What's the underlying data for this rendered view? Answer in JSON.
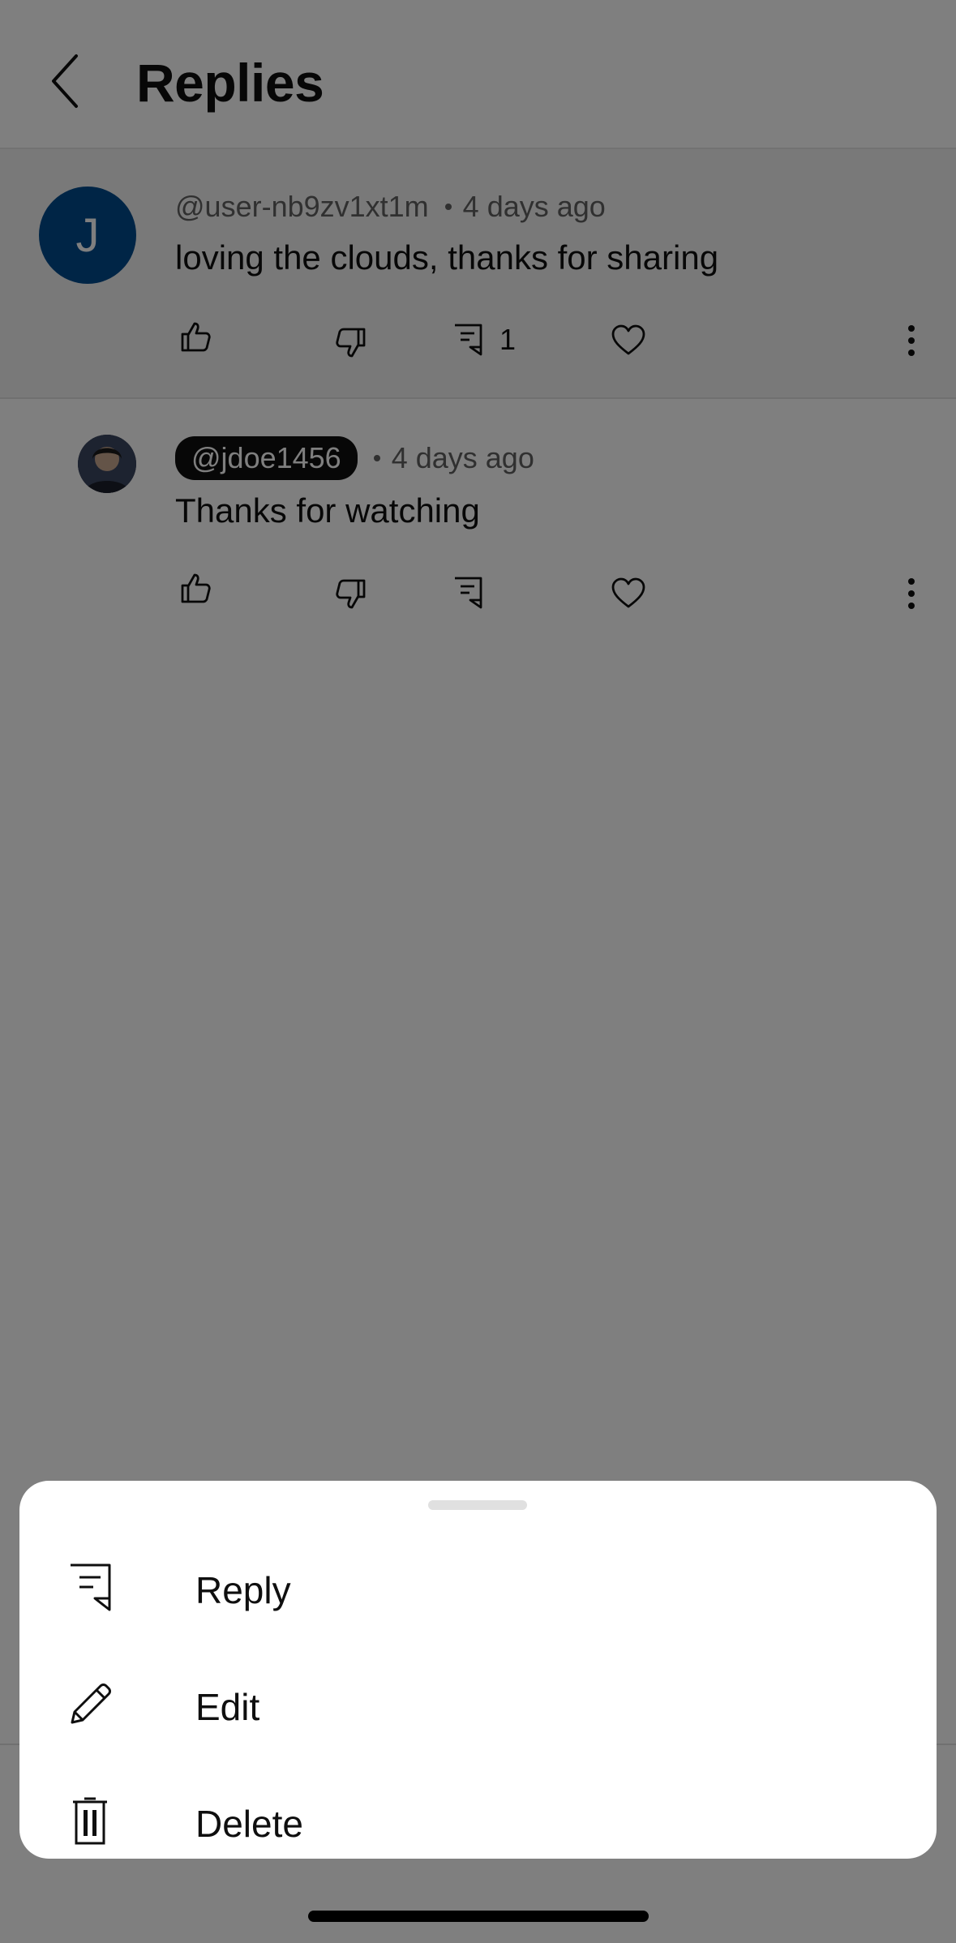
{
  "header": {
    "title": "Replies",
    "back_icon": "chevron-left-icon"
  },
  "parent_comment": {
    "avatar_letter": "J",
    "avatar_color": "#004b8c",
    "author": "@user-nb9zv1xt1m",
    "time": "4 days ago",
    "text": "loving the clouds, thanks for sharing",
    "reply_count": "1",
    "icons": [
      "like-icon",
      "dislike-icon",
      "reply-icon",
      "heart-icon",
      "more-vert-icon"
    ]
  },
  "reply": {
    "author": "@jdoe1456",
    "time": "4 days ago",
    "text": "Thanks for watching",
    "icons": [
      "like-icon",
      "dislike-icon",
      "reply-icon",
      "heart-icon",
      "more-vert-icon"
    ]
  },
  "sheet": {
    "items": [
      {
        "label": "Reply",
        "icon": "reply-icon"
      },
      {
        "label": "Edit",
        "icon": "pencil-icon"
      },
      {
        "label": "Delete",
        "icon": "trash-icon"
      }
    ]
  },
  "colors": {
    "scrim": "rgba(0,0,0,0.5)",
    "text": "#0f0f0f",
    "meta": "#606060"
  }
}
